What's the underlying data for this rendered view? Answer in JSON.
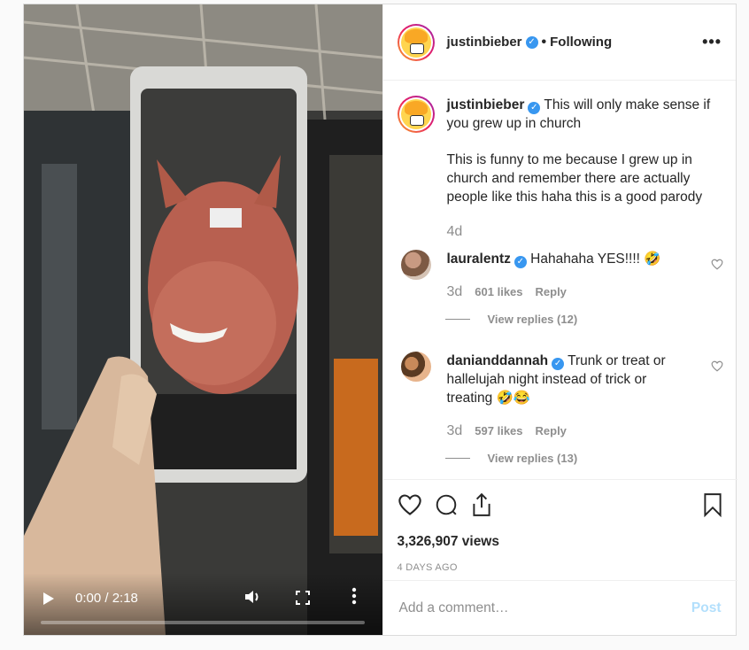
{
  "header": {
    "username": "justinbieber",
    "separator": "•",
    "follow_status": "Following",
    "more_label": "•••"
  },
  "caption": {
    "username": "justinbieber",
    "line1": "This will only make sense if you grew up in church",
    "body": "This is funny to me because I grew up in church and remember there are actually people like this haha this is a good parody",
    "age": "4d"
  },
  "comments": [
    {
      "username": "lauralentz",
      "text": "Hahahaha YES!!!! 🤣",
      "age": "3d",
      "likes": "601 likes",
      "reply": "Reply",
      "view_replies": "View replies (12)"
    },
    {
      "username": "danianddannah",
      "text": "Trunk or treat or hallelujah night instead of trick or treating 🤣😂",
      "age": "3d",
      "likes": "597 likes",
      "reply": "Reply",
      "view_replies": "View replies (13)"
    }
  ],
  "stats": {
    "views": "3,326,907 views",
    "posted": "4 DAYS AGO"
  },
  "add_comment": {
    "placeholder": "Add a comment…",
    "post_label": "Post"
  },
  "video": {
    "time": "0:00 / 2:18",
    "progress": 0.0,
    "icons": [
      "play-icon",
      "volume-icon",
      "fullscreen-icon",
      "more-vertical-icon"
    ]
  },
  "colors": {
    "verified": "#3897f0",
    "post_disabled": "#b2dffc",
    "muted": "#8e8e8e"
  }
}
